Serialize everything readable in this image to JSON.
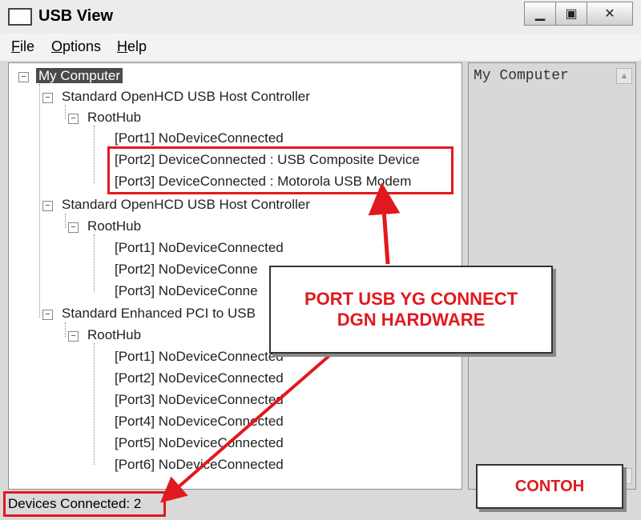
{
  "window": {
    "title": "USB View",
    "buttons": {
      "minimize": "▁",
      "maximize": "▣",
      "close": "✕"
    }
  },
  "menu": {
    "items": [
      {
        "underline": "F",
        "rest": "ile"
      },
      {
        "underline": "O",
        "rest": "ptions"
      },
      {
        "underline": "H",
        "rest": "elp"
      }
    ]
  },
  "tree": {
    "root": "My Computer",
    "controllers": [
      {
        "label": "Standard OpenHCD USB Host Controller",
        "hub": "RootHub",
        "ports": [
          "[Port1] NoDeviceConnected",
          "[Port2] DeviceConnected :  USB Composite Device",
          "[Port3] DeviceConnected :  Motorola USB Modem"
        ]
      },
      {
        "label": "Standard OpenHCD USB Host Controller",
        "hub": "RootHub",
        "ports": [
          "[Port1] NoDeviceConnected",
          "[Port2] NoDeviceConne",
          "[Port3] NoDeviceConne"
        ]
      },
      {
        "label": "Standard Enhanced PCI to USB",
        "hub": "RootHub",
        "ports": [
          "[Port1] NoDeviceConnected",
          "[Port2] NoDeviceConnected",
          "[Port3] NoDeviceConnected",
          "[Port4] NoDeviceConnected",
          "[Port5] NoDeviceConnected",
          "[Port6] NoDeviceConnected"
        ]
      }
    ]
  },
  "detail": {
    "text": "My Computer"
  },
  "status": {
    "text": "Devices Connected: 2"
  },
  "annotations": {
    "callout_main": [
      "PORT USB YG CONNECT",
      "DGN HARDWARE"
    ],
    "callout_example": "CONTOH",
    "accent_color": "#e0191e"
  }
}
